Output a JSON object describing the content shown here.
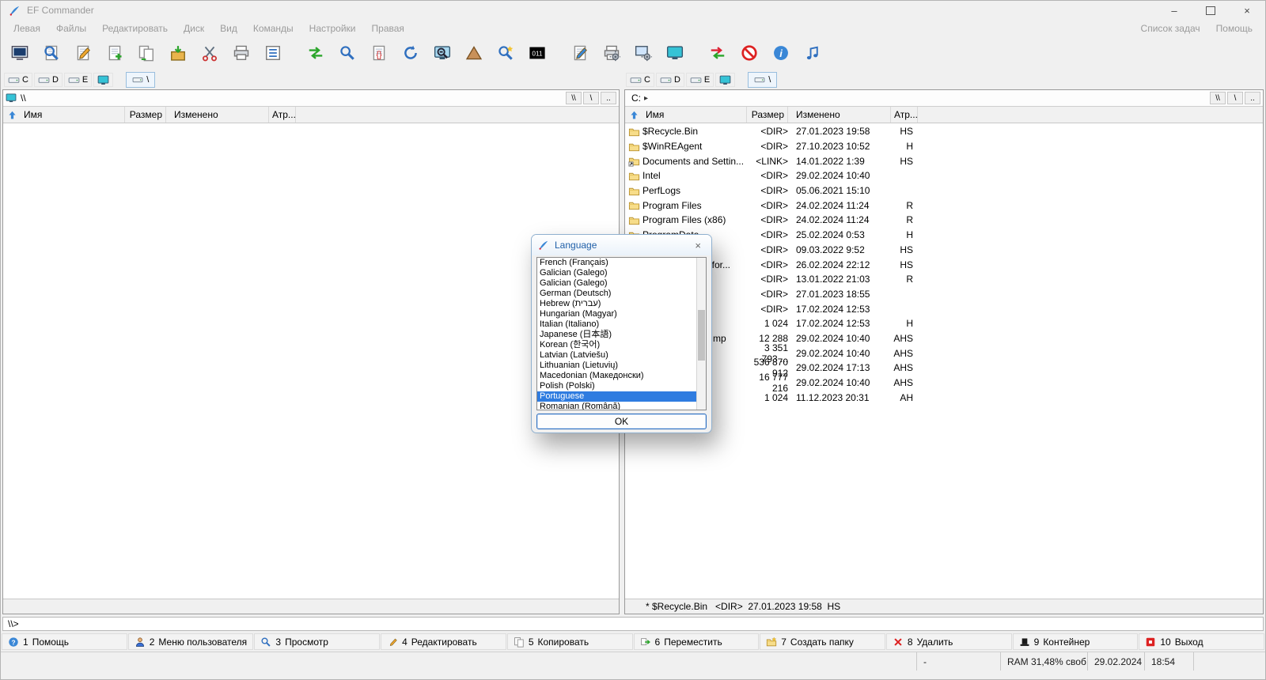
{
  "window": {
    "title": "EF Commander"
  },
  "menubar": {
    "left": [
      "Левая",
      "Файлы",
      "Редактировать",
      "Диск",
      "Вид",
      "Команды",
      "Настройки",
      "Правая"
    ],
    "right": [
      "Список задач",
      "Помощь"
    ]
  },
  "toolbar": {
    "groups": [
      [
        "terminal",
        "search-file",
        "edit-file",
        "new-file",
        "copy-file",
        "pack-file",
        "cut-file",
        "print-file",
        "view-list"
      ],
      [
        "swap-panels",
        "quick-search",
        "compare-files",
        "refresh-panel",
        "zoom-out",
        "tree-view",
        "advanced-search",
        "binary-view"
      ],
      [
        "edit-settings",
        "print-setup",
        "system-settings",
        "display-settings"
      ],
      [
        "sync-dirs",
        "abort",
        "info",
        "multimedia"
      ]
    ]
  },
  "path_buttons": [
    "\\\\",
    "\\",
    ".."
  ],
  "columns": [
    "Имя",
    "Размер",
    "Изменено",
    "Атр..."
  ],
  "panels": {
    "left": {
      "drives": [
        "C",
        "D",
        "E"
      ],
      "tab": "\\",
      "path": "\\\\",
      "rows": [],
      "info": ""
    },
    "right": {
      "drives": [
        "C",
        "D",
        "E"
      ],
      "tab": "\\",
      "path": "C:",
      "path_caret": "▸",
      "rows": [
        {
          "icon": "folder",
          "name": "$Recycle.Bin",
          "size": "<DIR>",
          "date": "27.01.2023 19:58",
          "attr": "HS"
        },
        {
          "icon": "folder",
          "name": "$WinREAgent",
          "size": "<DIR>",
          "date": "27.10.2023 10:52",
          "attr": "H"
        },
        {
          "icon": "link",
          "name": "Documents and Settin...",
          "size": "<LINK>",
          "date": "14.01.2022 1:39",
          "attr": "HS"
        },
        {
          "icon": "folder",
          "name": "Intel",
          "size": "<DIR>",
          "date": "29.02.2024 10:40",
          "attr": ""
        },
        {
          "icon": "folder",
          "name": "PerfLogs",
          "size": "<DIR>",
          "date": "05.06.2021 15:10",
          "attr": ""
        },
        {
          "icon": "folder",
          "name": "Program Files",
          "size": "<DIR>",
          "date": "24.02.2024 11:24",
          "attr": "R"
        },
        {
          "icon": "folder",
          "name": "Program Files (x86)",
          "size": "<DIR>",
          "date": "24.02.2024 11:24",
          "attr": "R"
        },
        {
          "icon": "folder",
          "name": "ProgramData",
          "size": "<DIR>",
          "date": "25.02.2024 0:53",
          "attr": "H"
        },
        {
          "icon": "folder",
          "name": "",
          "size": "<DIR>",
          "date": "09.03.2022 9:52",
          "attr": "HS"
        },
        {
          "icon": "folder",
          "name": "nfor...",
          "pad": 81,
          "size": "<DIR>",
          "date": "26.02.2024 22:12",
          "attr": "HS"
        },
        {
          "icon": "folder",
          "name": "",
          "size": "<DIR>",
          "date": "13.01.2022 21:03",
          "attr": "R"
        },
        {
          "icon": "folder",
          "name": "",
          "size": "<DIR>",
          "date": "27.01.2023 18:55",
          "attr": ""
        },
        {
          "icon": "folder",
          "name": "",
          "size": "<DIR>",
          "date": "17.02.2024 12:53",
          "attr": ""
        },
        {
          "icon": "file",
          "name": "",
          "size": "1 024",
          "date": "17.02.2024 12:53",
          "attr": "H"
        },
        {
          "icon": "file",
          "name": "mp",
          "pad": 89,
          "size": "12 288",
          "date": "29.02.2024 10:40",
          "attr": "AHS"
        },
        {
          "icon": "file",
          "name": "",
          "size": "3 351 793 ...",
          "date": "29.02.2024 10:40",
          "attr": "AHS"
        },
        {
          "icon": "file",
          "name": "",
          "size": "536 870 912",
          "date": "29.02.2024 17:13",
          "attr": "AHS"
        },
        {
          "icon": "file",
          "name": "",
          "size": "16 777 216",
          "date": "29.02.2024 10:40",
          "attr": "AHS"
        },
        {
          "icon": "file",
          "name": "",
          "size": "1 024",
          "date": "11.12.2023 20:31",
          "attr": "AH"
        }
      ],
      "info": "* $Recycle.Bin   <DIR>  27.01.2023 19:58  HS"
    }
  },
  "dialog": {
    "title": "Language",
    "languages": [
      "French (Français)",
      "Galician (Galego)",
      "Galician (Galego)",
      "German (Deutsch)",
      "Hebrew (עברית)",
      "Hungarian (Magyar)",
      "Italian (Italiano)",
      "Japanese (日本語)",
      "Korean (한국어)",
      "Latvian (Latviešu)",
      "Lithuanian (Lietuvių)",
      "Macedonian (Македонски)",
      "Polish (Polski)",
      "Portuguese",
      "Romanian (Română)"
    ],
    "selected": "Portuguese",
    "selected_index": 13,
    "ok": "OK"
  },
  "cmdline": {
    "prompt": "\\\\>"
  },
  "fkeys": [
    {
      "key": "1",
      "label": "Помощь",
      "icon": "help"
    },
    {
      "key": "2",
      "label": "Меню пользователя",
      "icon": "user"
    },
    {
      "key": "3",
      "label": "Просмотр",
      "icon": "view"
    },
    {
      "key": "4",
      "label": "Редактировать",
      "icon": "edit"
    },
    {
      "key": "5",
      "label": "Копировать",
      "icon": "copy"
    },
    {
      "key": "6",
      "label": "Переместить",
      "icon": "move"
    },
    {
      "key": "7",
      "label": "Создать папку",
      "icon": "mkdir"
    },
    {
      "key": "8",
      "label": "Удалить",
      "icon": "delete"
    },
    {
      "key": "9",
      "label": "Контейнер",
      "icon": "container"
    },
    {
      "key": "10",
      "label": "Выход",
      "icon": "exit"
    }
  ],
  "statusbar": {
    "segments": [
      "",
      "-",
      "RAM 31,48% своб...",
      "29.02.2024",
      "18:54",
      ""
    ]
  },
  "colors": {
    "selection": "#2f7ce0",
    "folder": "#f7dd8a",
    "dialog_title_text": "#1f5fa8"
  }
}
